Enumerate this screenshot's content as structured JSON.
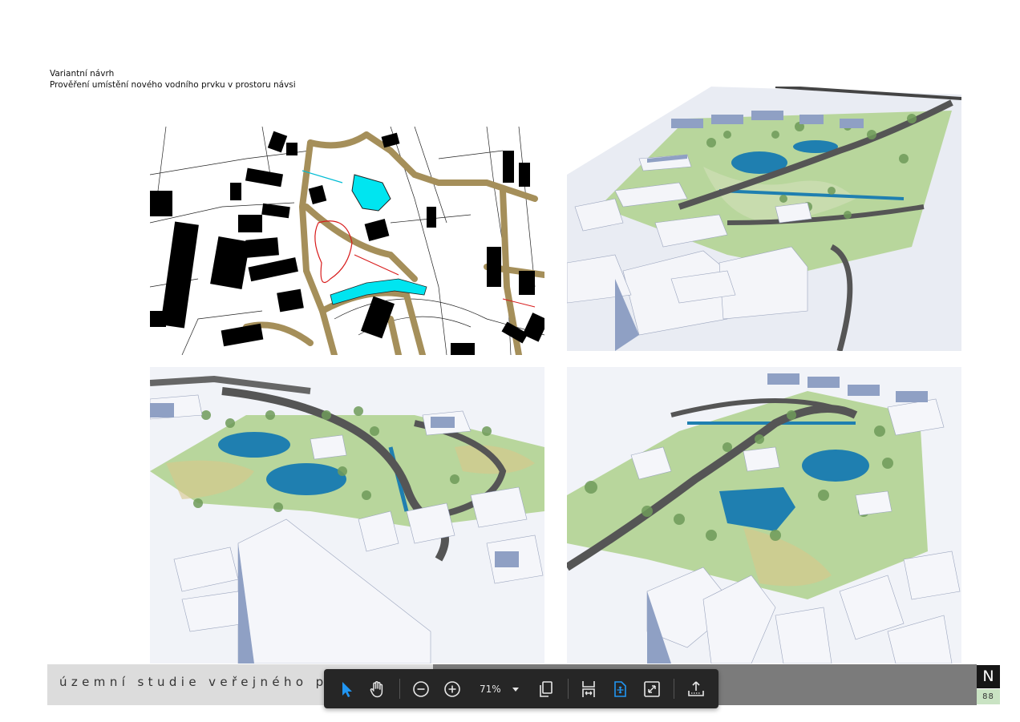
{
  "page": {
    "heading_line1": "Variantní návrh",
    "heading_line2": "Prověření umístění nového vodního prvku v prostoru návsi",
    "footer_title": "územní studie veřejného pr",
    "page_number": "88",
    "logo_glyph": "N"
  },
  "toolbar": {
    "zoom_value": "71%",
    "tools": [
      {
        "name": "select-tool",
        "icon": "pointer-icon",
        "active": true
      },
      {
        "name": "hand-tool",
        "icon": "hand-icon",
        "active": false
      },
      {
        "name": "zoom-out-button",
        "icon": "zoom-out-icon",
        "active": false
      },
      {
        "name": "zoom-in-button",
        "icon": "zoom-in-icon",
        "active": false
      },
      {
        "name": "page-layout-button",
        "icon": "pages-icon",
        "active": false
      },
      {
        "name": "fit-width-button",
        "icon": "fit-width-icon",
        "active": false
      },
      {
        "name": "fit-page-button",
        "icon": "fit-page-icon",
        "active": true
      },
      {
        "name": "fullscreen-button",
        "icon": "fullscreen-icon",
        "active": false
      },
      {
        "name": "export-button",
        "icon": "upload-icon",
        "active": false
      }
    ]
  },
  "colors": {
    "accent": "#2196f3",
    "toolbar_bg": "#262626",
    "water": "#1f7fb0",
    "water_plan": "#00e5f0",
    "path": "#a58f5a",
    "grass": "#b7d69a",
    "building": "#f2f3f7"
  },
  "figures": [
    {
      "id": "plan-drawing",
      "kind": "site-plan"
    },
    {
      "id": "aerial-view-1",
      "kind": "3d-render"
    },
    {
      "id": "aerial-view-2",
      "kind": "3d-render"
    },
    {
      "id": "aerial-view-3",
      "kind": "3d-render"
    }
  ]
}
